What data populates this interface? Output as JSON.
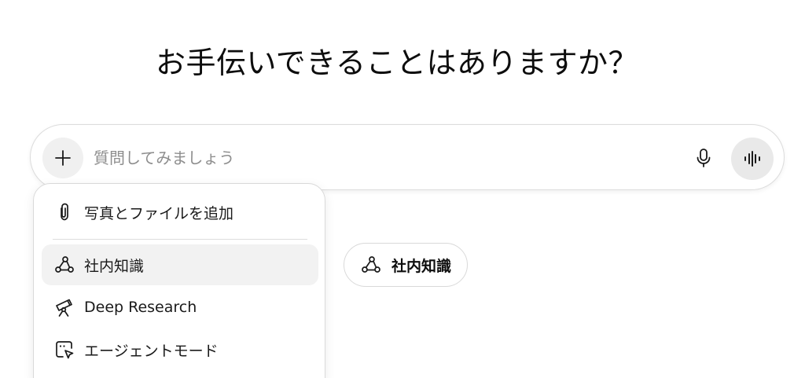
{
  "header": {
    "title": "お手伝いできることはありますか？"
  },
  "composer": {
    "placeholder": "質問してみましょう",
    "value": "",
    "icons": {
      "plus": "plus-icon",
      "mic": "microphone-icon",
      "voice": "voice-waveform-icon"
    }
  },
  "menu": {
    "items": [
      {
        "label": "写真とファイルを追加",
        "icon": "paperclip-icon",
        "active": false
      },
      {
        "label": "社内知識",
        "icon": "connected-nodes-icon",
        "active": true
      },
      {
        "label": "Deep Research",
        "icon": "telescope-icon",
        "active": false
      },
      {
        "label": "エージェントモード",
        "icon": "agent-cursor-icon",
        "active": false
      }
    ]
  },
  "chip": {
    "label": "社内知識",
    "icon": "connected-nodes-icon"
  },
  "colors": {
    "text": "#0d0d0d",
    "placeholder": "#8e8e8e",
    "border": "#dcdcdc",
    "button_bg": "#f0f0f0",
    "active_bg": "#f2f2f2"
  }
}
